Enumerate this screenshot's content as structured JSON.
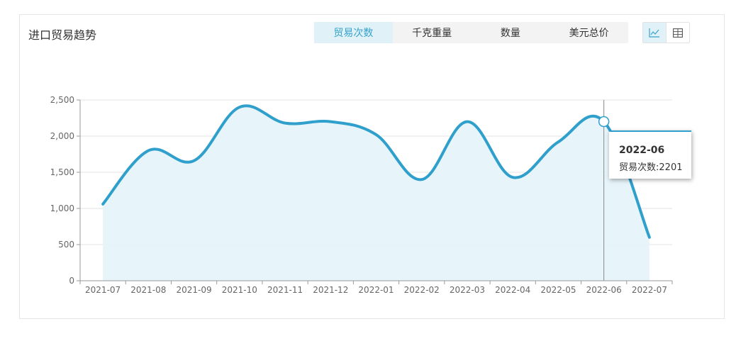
{
  "header": {
    "title": "进口贸易趋势"
  },
  "tabs": [
    {
      "label": "贸易次数",
      "active": true
    },
    {
      "label": "千克重量",
      "active": false
    },
    {
      "label": "数量",
      "active": false
    },
    {
      "label": "美元总价",
      "active": false
    }
  ],
  "view_toggle": {
    "line_icon": "line-chart-icon",
    "table_icon": "table-icon"
  },
  "colors": {
    "accent": "#2f9fcc",
    "area": "#e4f4fa",
    "active_tab_bg": "#e0f1f8"
  },
  "tooltip": {
    "title": "2022-06",
    "label": "贸易次数",
    "value": "2201"
  },
  "chart_data": {
    "type": "area",
    "x": [
      "2021-07",
      "2021-08",
      "2021-09",
      "2021-10",
      "2021-11",
      "2021-12",
      "2022-01",
      "2022-02",
      "2022-03",
      "2022-04",
      "2022-05",
      "2022-06",
      "2022-07"
    ],
    "series": [
      {
        "name": "贸易次数",
        "values": [
          1060,
          1800,
          1660,
          2400,
          2180,
          2200,
          2020,
          1400,
          2200,
          1430,
          1920,
          2201,
          600
        ]
      }
    ],
    "y_ticks": [
      "0",
      "500",
      "1,000",
      "1,500",
      "2,000",
      "2,500"
    ],
    "ylim": [
      0,
      2500
    ],
    "grid": true,
    "highlighted_index": 11
  }
}
